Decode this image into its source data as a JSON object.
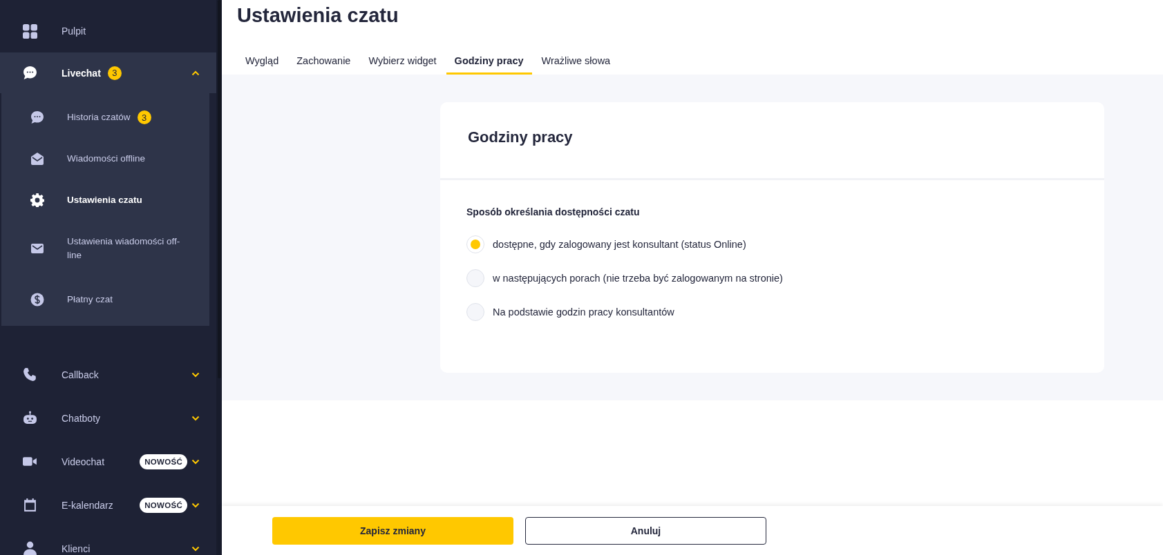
{
  "sidebar": {
    "items": [
      {
        "label": "Pulpit",
        "expanded": false,
        "has_chevron": false
      },
      {
        "label": "Livechat",
        "badge": "3",
        "expanded": true,
        "has_chevron": true,
        "children": [
          {
            "label": "Historia czatów",
            "badge": "3",
            "selected": false
          },
          {
            "label": "Wiadomości offline",
            "selected": false
          },
          {
            "label": "Ustawienia czatu",
            "selected": true
          },
          {
            "label": "Ustawienia wiadomości off-line",
            "selected": false
          },
          {
            "label": "Płatny czat",
            "selected": false
          }
        ]
      },
      {
        "label": "Callback",
        "expanded": false,
        "has_chevron": true
      },
      {
        "label": "Chatboty",
        "expanded": false,
        "has_chevron": true
      },
      {
        "label": "Videochat",
        "tag": "NOWOŚĆ",
        "expanded": false,
        "has_chevron": true
      },
      {
        "label": "E-kalendarz",
        "tag": "NOWOŚĆ",
        "expanded": false,
        "has_chevron": true
      },
      {
        "label": "Klienci",
        "expanded": false,
        "has_chevron": true
      }
    ]
  },
  "page_title": "Ustawienia czatu",
  "tabs": [
    {
      "label": "Wygląd",
      "selected": false
    },
    {
      "label": "Zachowanie",
      "selected": false
    },
    {
      "label": "Wybierz widget",
      "selected": false
    },
    {
      "label": "Godziny pracy",
      "selected": true
    },
    {
      "label": "Wrażliwe słowa",
      "selected": false
    }
  ],
  "card": {
    "title": "Godziny pracy",
    "section_label": "Sposób określania dostępności czatu",
    "options": [
      {
        "label": "dostępne, gdy zalogowany jest konsultant (status Online)",
        "selected": true
      },
      {
        "label": "w następujących porach (nie trzeba być zalogowanym na stronie)",
        "selected": false
      },
      {
        "label": "Na podstawie godzin pracy konsultantów",
        "selected": false
      }
    ]
  },
  "footer": {
    "save": "Zapisz zmiany",
    "cancel": "Anuluj"
  }
}
